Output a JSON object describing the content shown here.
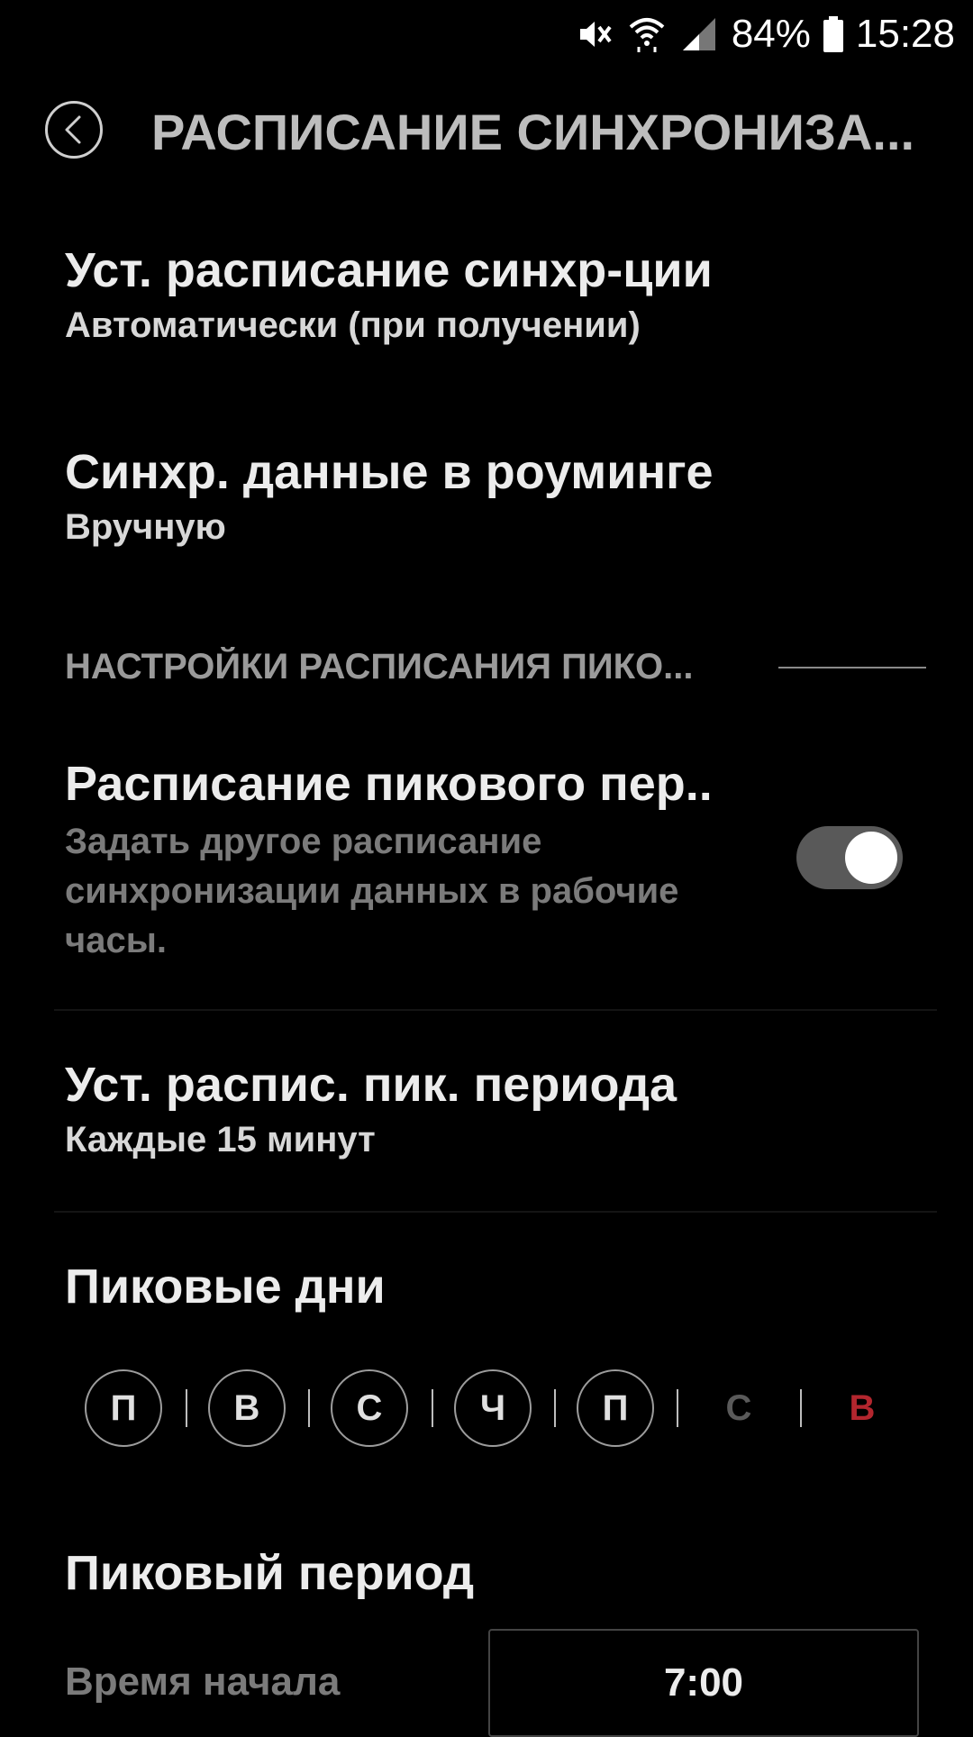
{
  "status_bar": {
    "battery": "84%",
    "time": "15:28",
    "icons": [
      "mute-vibrate-icon",
      "wifi-icon",
      "signal-icon",
      "battery-icon"
    ]
  },
  "header": {
    "title": "РАСПИСАНИЕ СИНХРОНИЗА...",
    "back_icon": "chevron-left-icon"
  },
  "items": {
    "sync_schedule": {
      "title": "Уст. расписание синхр-ции",
      "value": "Автоматически (при получении)"
    },
    "roaming": {
      "title": "Синхр. данные в роуминге",
      "value": "Вручную"
    },
    "peak_section": {
      "title": "НАСТРОЙКИ РАСПИСАНИЯ ПИКО..."
    },
    "peak_schedule": {
      "title": "Расписание пикового пер..",
      "description": "Задать другое расписание синхронизации данных в рабочие часы.",
      "enabled": true
    },
    "peak_sync": {
      "title": "Уст. распис. пик. периода",
      "value": "Каждые 15 минут"
    },
    "peak_days": {
      "title": "Пиковые дни",
      "days": [
        {
          "label": "П",
          "selected": true
        },
        {
          "label": "В",
          "selected": true
        },
        {
          "label": "С",
          "selected": true
        },
        {
          "label": "Ч",
          "selected": true
        },
        {
          "label": "П",
          "selected": true
        },
        {
          "label": "С",
          "selected": false
        },
        {
          "label": "В",
          "selected": false
        }
      ]
    },
    "peak_period": {
      "title": "Пиковый период",
      "start_label": "Время начала",
      "start_value": "7:00"
    }
  },
  "colors": {
    "background": "#000000",
    "sunday": "#b3262e",
    "toggle_track": "#595959"
  }
}
